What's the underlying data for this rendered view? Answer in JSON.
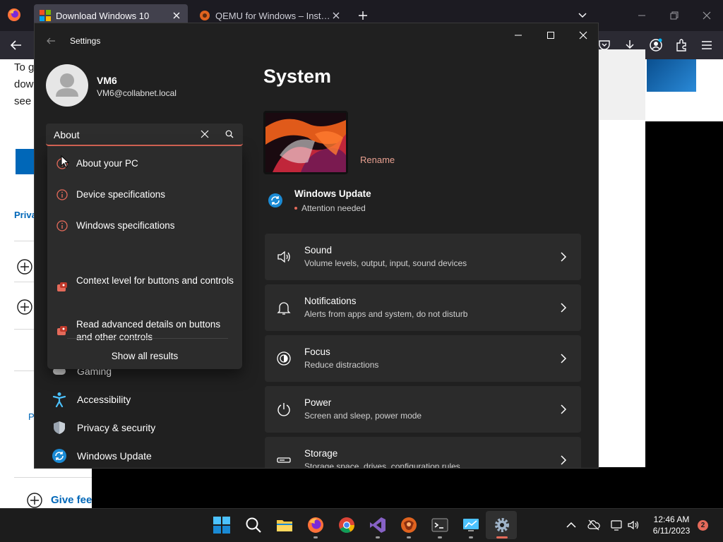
{
  "browser": {
    "tabs": [
      {
        "title": "Download Windows 10",
        "favicon": "windows-logo-icon",
        "active": true
      },
      {
        "title": "QEMU for Windows – Installers",
        "favicon": "qemu-icon",
        "active": false
      }
    ]
  },
  "web_page": {
    "line1": "To g",
    "line2": "dow",
    "line3": "see",
    "privacy_link": "Priva",
    "p_link": "P",
    "give_feedback": "Give fee"
  },
  "settings": {
    "window_title": "Settings",
    "user": {
      "name": "VM6",
      "email": "VM6@collabnet.local"
    },
    "search": {
      "value": "About"
    },
    "search_results": [
      {
        "label": "About your PC",
        "icon": "info-icon"
      },
      {
        "label": "Device specifications",
        "icon": "info-icon"
      },
      {
        "label": "Windows specifications",
        "icon": "info-icon"
      },
      {
        "label": "Context level for buttons and controls",
        "icon": "gamepad-icon"
      },
      {
        "label": "Read advanced details on buttons and other controls",
        "icon": "gamepad-icon"
      }
    ],
    "show_all_results": "Show all results",
    "nav": [
      {
        "label": "Gaming",
        "icon": "gaming-icon"
      },
      {
        "label": "Accessibility",
        "icon": "accessibility-icon"
      },
      {
        "label": "Privacy & security",
        "icon": "shield-icon"
      },
      {
        "label": "Windows Update",
        "icon": "windows-update-icon"
      }
    ],
    "page_title": "System",
    "rename_label": "Rename",
    "windows_update": {
      "title": "Windows Update",
      "status": "Attention needed"
    },
    "cards": [
      {
        "title": "Sound",
        "subtitle": "Volume levels, output, input, sound devices",
        "icon": "speaker-icon"
      },
      {
        "title": "Notifications",
        "subtitle": "Alerts from apps and system, do not disturb",
        "icon": "bell-icon"
      },
      {
        "title": "Focus",
        "subtitle": "Reduce distractions",
        "icon": "focus-icon"
      },
      {
        "title": "Power",
        "subtitle": "Screen and sleep, power mode",
        "icon": "power-icon"
      },
      {
        "title": "Storage",
        "subtitle": "Storage space, drives, configuration rules",
        "icon": "storage-icon"
      }
    ]
  },
  "taskbar": {
    "time": "12:46 AM",
    "date": "6/11/2023",
    "notification_count": "2"
  },
  "colors": {
    "accent": "#e46a5a",
    "link": "#0067b8",
    "window_bg": "#202020",
    "card_bg": "#2b2b2b"
  }
}
